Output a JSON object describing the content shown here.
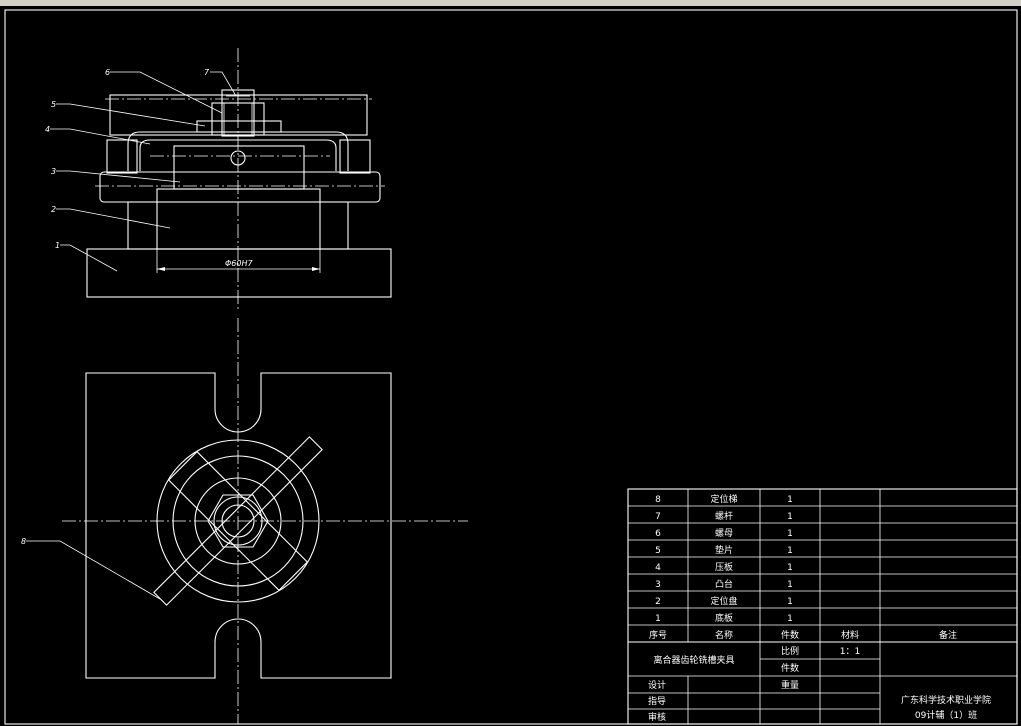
{
  "drawing": {
    "callouts": [
      "1",
      "2",
      "3",
      "4",
      "5",
      "6",
      "7",
      "8"
    ],
    "dimension": "Φ60H7"
  },
  "parts_list": {
    "rows": [
      {
        "no": "8",
        "name": "定位梯",
        "qty": "1"
      },
      {
        "no": "7",
        "name": "螺杆",
        "qty": "1"
      },
      {
        "no": "6",
        "name": "螺母",
        "qty": "1"
      },
      {
        "no": "5",
        "name": "垫片",
        "qty": "1"
      },
      {
        "no": "4",
        "name": "压板",
        "qty": "1"
      },
      {
        "no": "3",
        "name": "凸台",
        "qty": "1"
      },
      {
        "no": "2",
        "name": "定位盘",
        "qty": "1"
      },
      {
        "no": "1",
        "name": "底板",
        "qty": "1"
      }
    ],
    "headers": {
      "no": "序号",
      "name": "名称",
      "qty": "件数",
      "material": "材料",
      "remark": "备注"
    }
  },
  "title_block": {
    "drawing_name": "离合器齿轮铣槽夹具",
    "scale_label": "比例",
    "scale_value": "1：1",
    "qty_label": "件数",
    "weight_label": "重量",
    "design_label": "设计",
    "guide_label": "指导",
    "review_label": "审核",
    "school": "广东科学技术职业学院",
    "class": "09计辅（1）班"
  }
}
